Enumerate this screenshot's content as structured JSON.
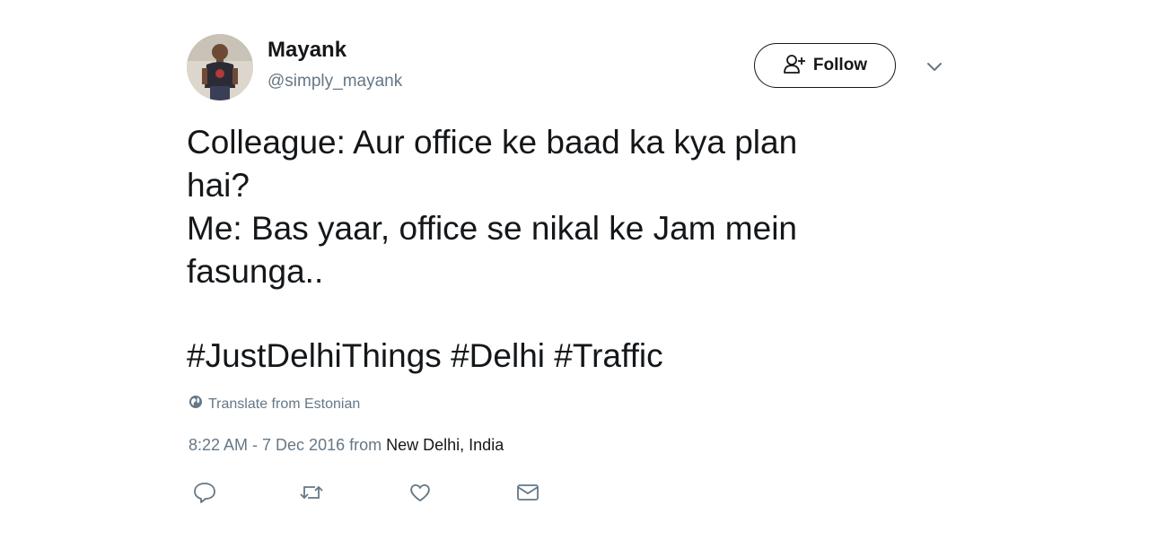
{
  "user": {
    "name": "Mayank",
    "handle": "@simply_mayank",
    "avatar_icon": "profile-photo"
  },
  "follow_button": {
    "icon": "add-user-icon",
    "label": "Follow"
  },
  "menu": {
    "icon": "chevron-down-icon"
  },
  "tweet": {
    "lines": [
      "Colleague: Aur office ke baad ka kya plan",
      "hai?",
      "Me: Bas yaar, office se nikal ke Jam mein",
      "fasunga.."
    ],
    "hashtags": [
      "#JustDelhiThings",
      "#Delhi",
      "#Traffic"
    ]
  },
  "translate": {
    "icon": "globe-icon",
    "label": "Translate from Estonian"
  },
  "meta": {
    "timestamp": "8:22 AM - 7 Dec 2016",
    "from_label": "from",
    "place": "New Delhi, India"
  },
  "actions": [
    {
      "name": "reply",
      "icon": "reply-icon"
    },
    {
      "name": "retweet",
      "icon": "retweet-icon"
    },
    {
      "name": "like",
      "icon": "heart-icon"
    },
    {
      "name": "message",
      "icon": "mail-icon"
    }
  ],
  "colors": {
    "text": "#14171a",
    "secondary": "#657786",
    "background": "#ffffff"
  }
}
